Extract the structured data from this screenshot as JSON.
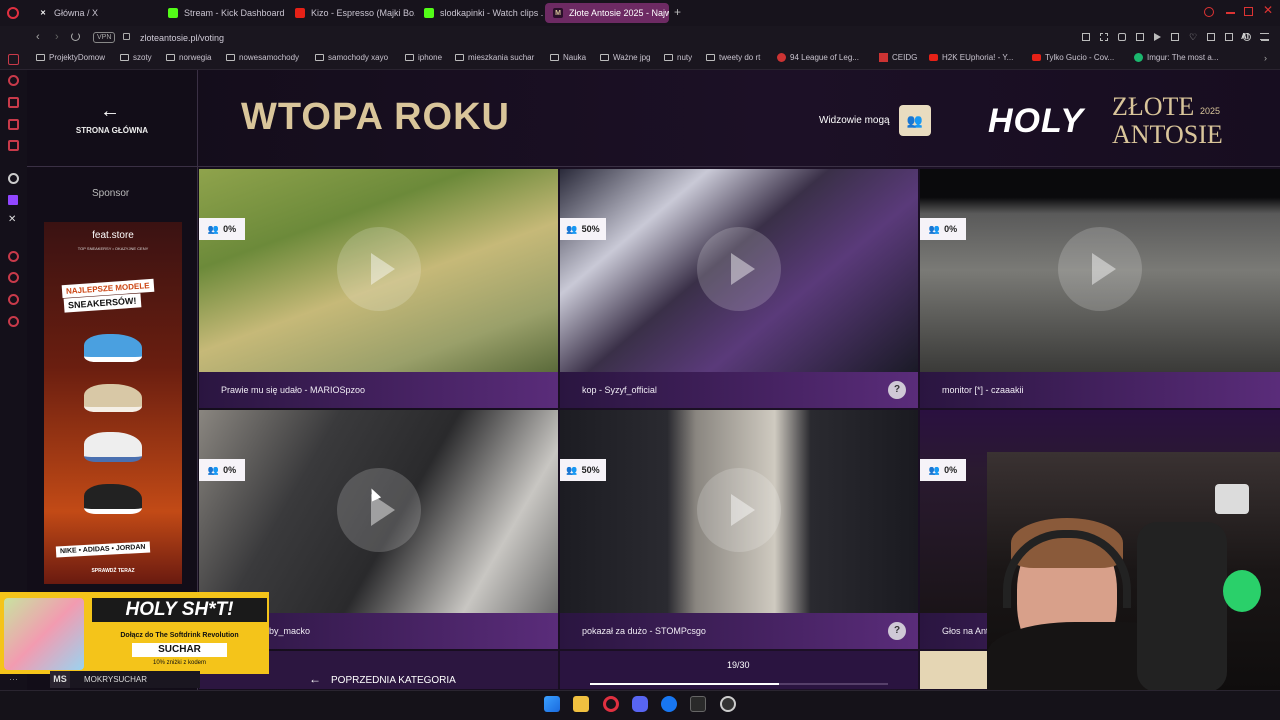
{
  "browser": {
    "tabs": [
      {
        "label": "Główna / X",
        "icon": "x-icon"
      },
      {
        "label": "Stream - Kick Dashboard",
        "icon": "kick-icon"
      },
      {
        "label": "Kizo - Espresso (Majki Bo...",
        "icon": "youtube-icon"
      },
      {
        "label": "slodkapinki - Watch clips ...",
        "icon": "kick-icon"
      },
      {
        "label": "Złote Antosie 2025 - Najw...",
        "icon": "za-icon"
      }
    ],
    "new_tab": "+",
    "vpn": "VPN",
    "url": "zloteantosie.pl/voting",
    "ai_label": "AI",
    "bookmarks": [
      "ProjektyDomow",
      "szoty",
      "norwegia",
      "nowesamochody",
      "samochody xayo",
      "iphone",
      "mieszkania suchar",
      "Nauka",
      "Ważne jpg",
      "nuty",
      "tweety do rt",
      "94 League of Leg...",
      "CEIDG",
      "H2K EUphoria! - Y...",
      "Tylko Gucio - Cov...",
      "Imgur: The most a..."
    ]
  },
  "page": {
    "back_arrow": "←",
    "back_label": "STRONA GŁÓWNA",
    "category_title": "WTOPA ROKU",
    "viewers_label": "Widzowie mogą",
    "logo_holy": "HOLY",
    "logo_zlote": "ZŁOTE",
    "logo_year": "2025",
    "logo_antosie": "ANTOSIE",
    "sponsor_label": "Sponsor",
    "ad": {
      "store": "feat.store",
      "store_sub": "TOP SNEAKERSY • OKAZYJNE CENY",
      "headline1": "NAJLEPSZE MODELE",
      "headline2": "SNEAKERSÓW!",
      "brands": "NIKE • ADIDAS • JORDAN",
      "cta": "SPRAWDŹ TERAZ"
    },
    "videos": [
      {
        "percent": "0%",
        "caption": "Prawie mu się udało - MARIOSpzoo",
        "question": ""
      },
      {
        "percent": "50%",
        "caption": "kop - Syzyf_official",
        "question": "?"
      },
      {
        "percent": "0%",
        "caption": "monitor [*] - czaaakii",
        "question": ""
      },
      {
        "percent": "0%",
        "caption": "by_macko",
        "question": ""
      },
      {
        "percent": "50%",
        "caption": "pokazał za dużo - STOMPcsgo",
        "question": "?"
      },
      {
        "percent": "0%",
        "caption": "Głos na Ant",
        "question": ""
      }
    ],
    "prev_arrow": "←",
    "prev_label": "POPRZEDNIA KATEGORIA",
    "progress": "19/30",
    "progress_value": 0.633
  },
  "overlay": {
    "holy_title": "HOLY SH*T!",
    "holy_sub": "Dołącz do The Softdrink Revolution",
    "code": "SUCHAR",
    "discount": "10% zniżki z kodem",
    "streamer_badge": "MS",
    "streamer_name": "MOKRYSUCHAR"
  },
  "colors": {
    "accent": "#5a2c7a",
    "gold": "#d9c59a",
    "tab_active": "#6d2a63"
  }
}
